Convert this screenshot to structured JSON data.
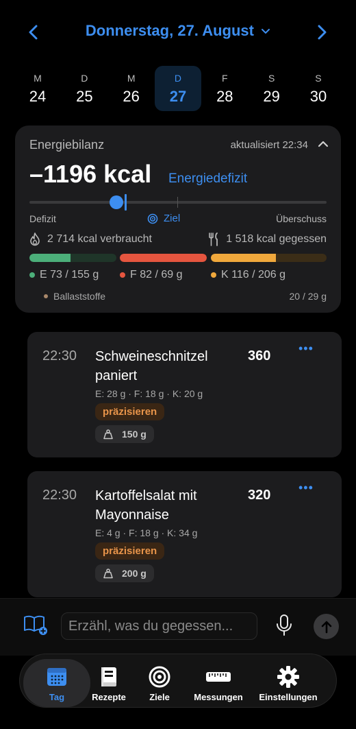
{
  "header": {
    "date_title": "Donnerstag, 27. August",
    "prev_icon": "chevron-left-icon",
    "next_icon": "chevron-right-icon"
  },
  "week": [
    {
      "weekday": "M",
      "day": "24",
      "active": false
    },
    {
      "weekday": "D",
      "day": "25",
      "active": false
    },
    {
      "weekday": "M",
      "day": "26",
      "active": false
    },
    {
      "weekday": "D",
      "day": "27",
      "active": true
    },
    {
      "weekday": "F",
      "day": "28",
      "active": false
    },
    {
      "weekday": "S",
      "day": "29",
      "active": false
    },
    {
      "weekday": "S",
      "day": "30",
      "active": false
    }
  ],
  "energy": {
    "title": "Energiebilanz",
    "updated": "aktualisiert 22:34",
    "balance": "–1196 kcal",
    "status": "Energiedefizit",
    "slider_left": "Defizit",
    "slider_mid": "Ziel",
    "slider_right": "Überschuss",
    "burned": "2 714 kcal verbraucht",
    "eaten": "1 518 kcal gegessen",
    "macros": [
      {
        "label": "E 73 / 155 g",
        "fraction": 0.47,
        "color": "#4caf7a",
        "track": "#1f3529"
      },
      {
        "label": "F 82 / 69 g",
        "fraction": 1.0,
        "color": "#e5553f",
        "track": "#3a1f1a"
      },
      {
        "label": "K 116 / 206 g",
        "fraction": 0.56,
        "color": "#f0a83c",
        "track": "#3b2d17"
      }
    ],
    "fiber_label": "Ballaststoffe",
    "fiber_value": "20 / 29 g",
    "fiber_color": "#a8876a"
  },
  "meals": [
    {
      "time": "22:30",
      "name": "Schweineschnitzel paniert",
      "kcal": "360",
      "macros": "E: 28 g · F: 18 g · K: 20 g",
      "refine": "präzisieren",
      "weight": "150 g",
      "more": "•••"
    },
    {
      "time": "22:30",
      "name": "Kartoffelsalat mit Mayonnaise",
      "kcal": "320",
      "macros": "E: 4 g · F: 18 g · K: 34 g",
      "refine": "präzisieren",
      "weight": "200 g",
      "more": "•••"
    }
  ],
  "input": {
    "placeholder": "Erzähl, was du gegessen..."
  },
  "tabs": [
    {
      "label": "Tag",
      "icon": "calendar-icon",
      "active": true
    },
    {
      "label": "Rezepte",
      "icon": "recipe-book-icon",
      "active": false
    },
    {
      "label": "Ziele",
      "icon": "target-icon",
      "active": false
    },
    {
      "label": "Messungen",
      "icon": "ruler-icon",
      "active": false
    },
    {
      "label": "Einstellungen",
      "icon": "gear-icon",
      "active": false
    }
  ],
  "accent": "#3d8ef0"
}
